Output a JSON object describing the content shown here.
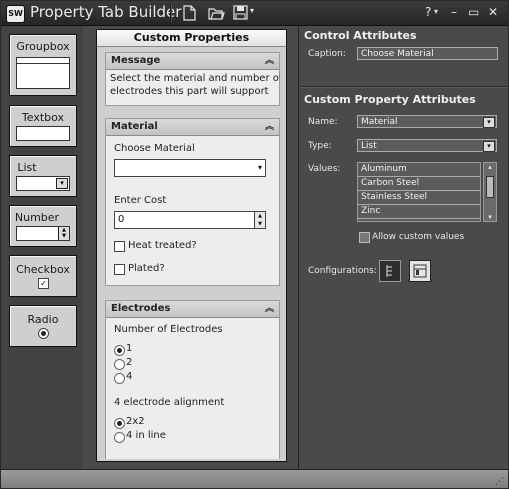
{
  "app": {
    "icon_text": "SW",
    "title": "Property Tab Builder",
    "help_label": "?",
    "minimize": "–",
    "maximize": "▭",
    "close": "✕"
  },
  "palette": {
    "groupbox": "Groupbox",
    "textbox": "Textbox",
    "list": "List",
    "number": "Number",
    "checkbox": "Checkbox",
    "radio": "Radio"
  },
  "center": {
    "title": "Custom Properties",
    "message": {
      "header": "Message",
      "text_line1": "Select the material and number of",
      "text_line2": "electrodes this part will support"
    },
    "material": {
      "header": "Material",
      "choose_label": "Choose Material",
      "choose_value": "",
      "cost_label": "Enter Cost",
      "cost_value": "0",
      "heat_treated": "Heat treated?",
      "plated": "Plated?"
    },
    "electrodes": {
      "header": "Electrodes",
      "count_label": "Number of Electrodes",
      "options": [
        "1",
        "2",
        "4"
      ],
      "selected": "1",
      "align_label": "4 electrode alignment",
      "align_options": [
        "2x2",
        "4 in line"
      ],
      "align_selected": "2x2"
    }
  },
  "right": {
    "control_title": "Control Attributes",
    "caption_label": "Caption:",
    "caption_value": "Choose Material",
    "custom_title": "Custom Property Attributes",
    "name_label": "Name:",
    "name_value": "Material",
    "type_label": "Type:",
    "type_value": "List",
    "values_label": "Values:",
    "values": [
      "Aluminum",
      "Carbon Steel",
      "Stainless Steel",
      "Zinc"
    ],
    "allow_custom": "Allow custom values",
    "configurations_label": "Configurations:"
  }
}
